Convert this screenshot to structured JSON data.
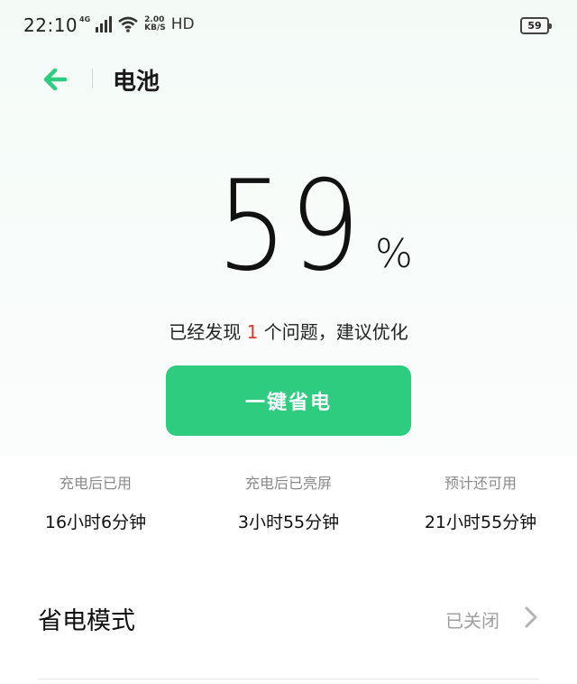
{
  "status_bar": {
    "time": "22:10",
    "network": "4G",
    "speed_value": "2.00",
    "speed_unit": "KB/S",
    "hd": "HD",
    "battery_level": "59"
  },
  "header": {
    "title": "电池"
  },
  "battery": {
    "percent": "59",
    "percent_sign": "%",
    "issue_prefix": "已经发现 ",
    "issue_count": "1",
    "issue_suffix": " 个问题，建议优化",
    "optimize_label": "一键省电"
  },
  "stats": [
    {
      "label": "充电后已用",
      "value": "16小时6分钟"
    },
    {
      "label": "充电后已亮屏",
      "value": "3小时55分钟"
    },
    {
      "label": "预计还可用",
      "value": "21小时55分钟"
    }
  ],
  "power_saving": {
    "label": "省电模式",
    "status": "已关闭"
  },
  "colors": {
    "accent": "#2ecc7f",
    "issue": "#e0382f"
  },
  "icons": {
    "back": "arrow-left-icon",
    "chevron": "chevron-right-icon"
  }
}
